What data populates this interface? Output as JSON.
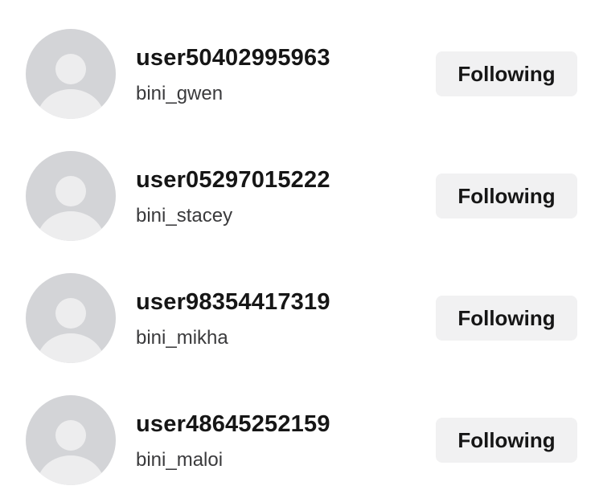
{
  "following_list": [
    {
      "username": "user50402995963",
      "handle": "bini_gwen",
      "button_label": "Following"
    },
    {
      "username": "user05297015222",
      "handle": "bini_stacey",
      "button_label": "Following"
    },
    {
      "username": "user98354417319",
      "handle": "bini_mikha",
      "button_label": "Following"
    },
    {
      "username": "user48645252159",
      "handle": "bini_maloi",
      "button_label": "Following"
    }
  ],
  "colors": {
    "avatar_bg": "#d3d4d7",
    "avatar_figure": "#ededee",
    "button_bg": "#f1f1f2",
    "primary_text": "#161616"
  }
}
